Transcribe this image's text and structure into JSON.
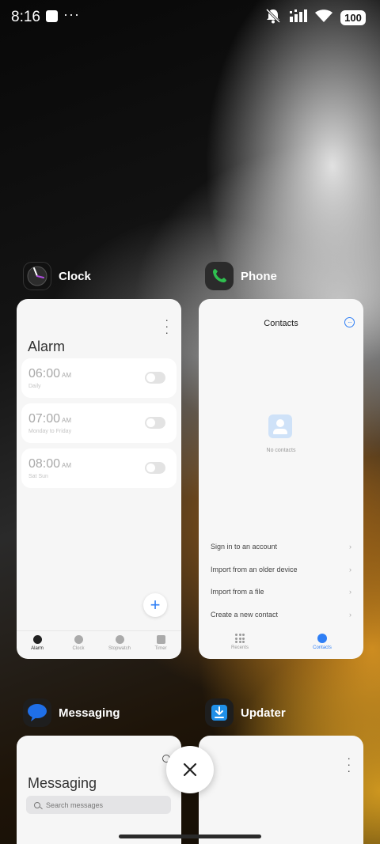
{
  "status_bar": {
    "time": "8:16",
    "overflow_dots": "···",
    "battery": "100"
  },
  "apps": {
    "clock": {
      "name": "Clock",
      "screen_title": "Alarm",
      "alarms": [
        {
          "time": "06:00",
          "ampm": "AM",
          "repeat": "Daily"
        },
        {
          "time": "07:00",
          "ampm": "AM",
          "repeat": "Monday to Friday"
        },
        {
          "time": "08:00",
          "ampm": "AM",
          "repeat": "Sat Sun"
        }
      ],
      "add_label": "+",
      "nav": [
        "Alarm",
        "Clock",
        "Stopwatch",
        "Timer"
      ]
    },
    "phone": {
      "name": "Phone",
      "screen_title": "Contacts",
      "empty_text": "No contacts",
      "options": [
        "Sign in to an account",
        "Import from an older device",
        "Import from a file",
        "Create a new contact"
      ],
      "chevron": "›",
      "nav": [
        "Recents",
        "Contacts"
      ]
    },
    "messaging": {
      "name": "Messaging",
      "screen_title": "Messaging",
      "search_placeholder": "Search messages"
    },
    "updater": {
      "name": "Updater"
    }
  },
  "colors": {
    "accent": "#2f7ff5",
    "card_bg": "#f6f6f6",
    "phone_icon": "#2fbf4f"
  }
}
